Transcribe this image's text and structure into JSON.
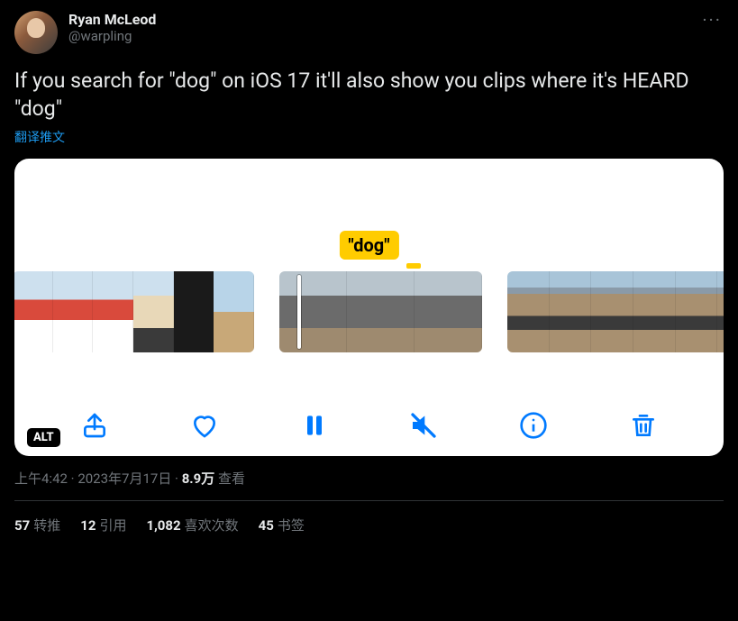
{
  "author": {
    "display_name": "Ryan McLeod",
    "handle": "@warpling"
  },
  "more_label": "···",
  "body": "If you search for \"dog\" on iOS 17 it'll also show you clips where it's HEARD \"dog\"",
  "translate_label": "翻译推文",
  "media": {
    "search_token": "\"dog\"",
    "alt_badge": "ALT",
    "toolbar_icons": [
      "share",
      "heart",
      "pause",
      "mute",
      "info",
      "trash"
    ]
  },
  "meta": {
    "time": "上午4:42",
    "sep": " · ",
    "date": "2023年7月17日",
    "views_count": "8.9万",
    "views_label": " 查看"
  },
  "stats": {
    "retweets": {
      "count": "57",
      "label": "转推"
    },
    "quotes": {
      "count": "12",
      "label": "引用"
    },
    "likes": {
      "count": "1,082",
      "label": "喜欢次数"
    },
    "bookmarks": {
      "count": "45",
      "label": "书签"
    }
  }
}
